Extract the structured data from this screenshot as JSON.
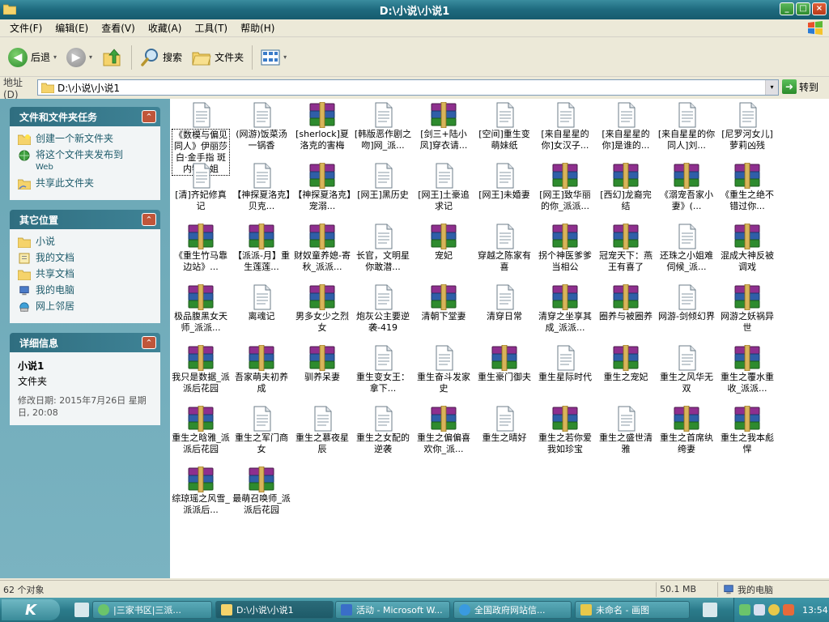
{
  "window": {
    "title": "D:\\小说\\小说1",
    "min_label": "_",
    "max_label": "□",
    "close_label": "×"
  },
  "menu": [
    "文件(F)",
    "编辑(E)",
    "查看(V)",
    "收藏(A)",
    "工具(T)",
    "帮助(H)"
  ],
  "toolbar": {
    "back": "后退",
    "back_glyph": "◀",
    "forward_glyph": "▶",
    "dropdown_glyph": "▾",
    "search": "搜索",
    "folders": "文件夹"
  },
  "address": {
    "label": "地址(D)",
    "path": "D:\\小说\\小说1",
    "dropdown_glyph": "▾",
    "go": "转到",
    "go_glyph": "➜"
  },
  "panels": {
    "tasks": {
      "title": "文件和文件夹任务",
      "toggle": "^",
      "items": [
        {
          "label": "创建一个新文件夹",
          "sub": ""
        },
        {
          "label": "将这个文件夹发布到",
          "sub": "Web"
        },
        {
          "label": "共享此文件夹",
          "sub": ""
        }
      ]
    },
    "places": {
      "title": "其它位置",
      "toggle": "^",
      "items": [
        "小说",
        "我的文档",
        "共享文档",
        "我的电脑",
        "网上邻居"
      ]
    },
    "details": {
      "title": "详细信息",
      "toggle": "^",
      "name": "小说1",
      "type": "文件夹",
      "date": "修改日期: 2015年7月26日 星期日, 20:08"
    }
  },
  "files": [
    {
      "name": "《数模与偏见同人》伊丽莎白·金手指 斑内特小姐",
      "type": "txt"
    },
    {
      "name": "(网游)饭菜汤一锅香",
      "type": "txt"
    },
    {
      "name": "[sherlock]夏洛克的害梅",
      "type": "rar"
    },
    {
      "name": "[韩版恶作剧之吻]网_派...",
      "type": "txt"
    },
    {
      "name": "[剑三+陆小凤]穿衣请...",
      "type": "rar"
    },
    {
      "name": "[空间]重生变萌妹纸",
      "type": "txt"
    },
    {
      "name": "[来自星星的你]女汉子...",
      "type": "txt"
    },
    {
      "name": "[来自星星的你]是谁的...",
      "type": "txt"
    },
    {
      "name": "[来自星星的你同人]刘...",
      "type": "txt"
    },
    {
      "name": "[尼罗河女儿]萝莉凶残",
      "type": "txt"
    },
    {
      "name": "[清]齐妃修真记",
      "type": "txt"
    },
    {
      "name": "【神探夏洛克】贝克...",
      "type": "txt"
    },
    {
      "name": "【神探夏洛克】宠溺...",
      "type": "rar"
    },
    {
      "name": "[网王]黑历史",
      "type": "txt"
    },
    {
      "name": "[网王]土豪追求记",
      "type": "txt"
    },
    {
      "name": "[网王]未婚妻",
      "type": "txt"
    },
    {
      "name": "[网王]致华丽的你_派派...",
      "type": "rar"
    },
    {
      "name": "[西幻]龙裔完结",
      "type": "rar"
    },
    {
      "name": "《溺宠吾家小妻》(...",
      "type": "rar"
    },
    {
      "name": "《重生之绝不错过你...",
      "type": "rar"
    },
    {
      "name": "《重生竹马靠边站》...",
      "type": "rar"
    },
    {
      "name": "【派派-月】重生莲莲...",
      "type": "rar"
    },
    {
      "name": "财奴童养媳-寄秋_派派...",
      "type": "rar"
    },
    {
      "name": "长官，文明星你敢潜...",
      "type": "txt"
    },
    {
      "name": "宠妃",
      "type": "rar"
    },
    {
      "name": "穿越之陈家有喜",
      "type": "txt"
    },
    {
      "name": "拐个神医爹爹当相公",
      "type": "rar"
    },
    {
      "name": "冠宠天下：燕王有喜了",
      "type": "rar"
    },
    {
      "name": "还珠之小姐难伺候_派...",
      "type": "txt"
    },
    {
      "name": "混成大神反被调戏",
      "type": "rar"
    },
    {
      "name": "极品腹黑女天师_派派...",
      "type": "rar"
    },
    {
      "name": "离魂记",
      "type": "txt"
    },
    {
      "name": "男多女少之烈女",
      "type": "rar"
    },
    {
      "name": "炮灰公主要逆袭-419",
      "type": "txt"
    },
    {
      "name": "清朝下堂妻",
      "type": "rar"
    },
    {
      "name": "清穿日常",
      "type": "txt"
    },
    {
      "name": "清穿之坐享其成_派派...",
      "type": "rar"
    },
    {
      "name": "圈养与被圈养",
      "type": "rar"
    },
    {
      "name": "网游-剑倾幻界",
      "type": "txt"
    },
    {
      "name": "网游之妖祸异世",
      "type": "rar"
    },
    {
      "name": "我只是数据_派派后花园",
      "type": "rar"
    },
    {
      "name": "吾家萌夫初养成",
      "type": "rar"
    },
    {
      "name": "驯养呆妻",
      "type": "rar"
    },
    {
      "name": "重生变女王：拿下...",
      "type": "txt"
    },
    {
      "name": "重生奋斗发家史",
      "type": "txt"
    },
    {
      "name": "重生豪门御夫",
      "type": "rar"
    },
    {
      "name": "重生星际时代",
      "type": "txt"
    },
    {
      "name": "重生之宠妃",
      "type": "rar"
    },
    {
      "name": "重生之风华无双",
      "type": "txt"
    },
    {
      "name": "重生之覆水重收_派派...",
      "type": "rar"
    },
    {
      "name": "重生之晗雅_派派后花园",
      "type": "rar"
    },
    {
      "name": "重生之军门商女",
      "type": "txt"
    },
    {
      "name": "重生之慕夜星辰",
      "type": "txt"
    },
    {
      "name": "重生之女配的逆袭",
      "type": "txt"
    },
    {
      "name": "重生之偏偏喜欢你_派...",
      "type": "rar"
    },
    {
      "name": "重生之晴好",
      "type": "txt"
    },
    {
      "name": "重生之若你爱我如珍宝",
      "type": "rar"
    },
    {
      "name": "重生之盛世清雅",
      "type": "txt"
    },
    {
      "name": "重生之首席纨绔妻",
      "type": "rar"
    },
    {
      "name": "重生之我本彪悍",
      "type": "rar"
    },
    {
      "name": "综琼瑶之风雪_派派后...",
      "type": "rar"
    },
    {
      "name": "最萌召唤师_派派后花园",
      "type": "rar"
    }
  ],
  "status": {
    "count": "62 个对象",
    "size": "50.1 MB",
    "location": "我的电脑"
  },
  "taskbar": {
    "start_label": "K",
    "items": [
      "|三家书区|三派...",
      "D:\\小说\\小说1",
      "活动 - Microsoft W...",
      "全国政府网站信...",
      "未命名 - 画图"
    ],
    "clock": "13:54"
  },
  "colors": {
    "txt_icon": "#FFFFFF",
    "rar_top": "#8E2F8E",
    "rar_mid": "#2F5EA8",
    "rar_bot": "#2E8B2E",
    "panel_link": "#1E5B6B"
  }
}
